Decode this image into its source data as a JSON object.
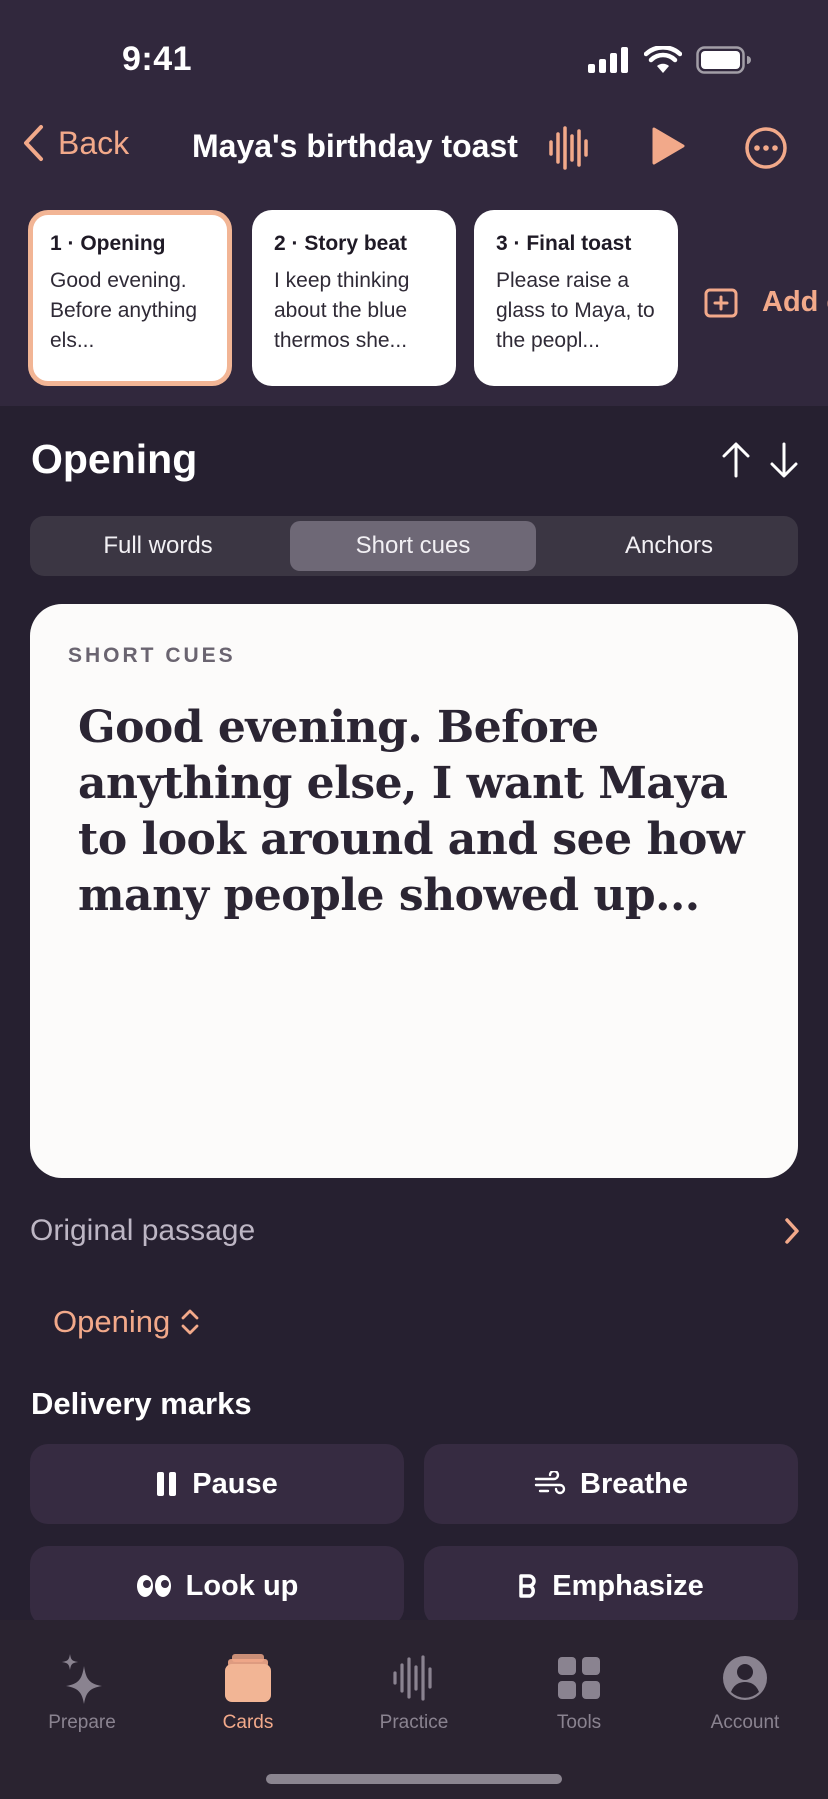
{
  "status_bar": {
    "time": "9:41"
  },
  "nav": {
    "back_label": "Back",
    "title": "Maya's birthday toast",
    "icons": [
      "chevron-left-icon",
      "waveform-icon",
      "play-icon",
      "more-icon"
    ]
  },
  "cards": [
    {
      "title": "1 · Opening",
      "preview": "Good evening. Before anything els..."
    },
    {
      "title": "2 · Story beat",
      "preview": "I keep thinking about the blue thermos she..."
    },
    {
      "title": "3 · Final toast",
      "preview": "Please raise a glass to Maya, to the peopl..."
    }
  ],
  "add_card_label": "Add c",
  "section": {
    "title": "Opening"
  },
  "modes": {
    "options": [
      "Full words",
      "Short cues",
      "Anchors"
    ],
    "selected": "Short cues"
  },
  "cue_card": {
    "label": "SHORT CUES",
    "text": "Good evening. Before anything else, I want Maya to look around and see how many people showed up..."
  },
  "original_passage": {
    "label": "Original passage"
  },
  "picker": {
    "value": "Opening"
  },
  "delivery_marks": {
    "title": "Delivery marks",
    "items": [
      {
        "label": "Pause",
        "icon": "pause-icon"
      },
      {
        "label": "Breathe",
        "icon": "wind-icon"
      },
      {
        "label": "Look up",
        "icon": "eyes-icon"
      },
      {
        "label": "Emphasize",
        "icon": "bold-icon"
      }
    ]
  },
  "tabs": [
    {
      "label": "Prepare",
      "icon": "sparkles-icon"
    },
    {
      "label": "Cards",
      "icon": "cards-icon"
    },
    {
      "label": "Practice",
      "icon": "waveform-icon"
    },
    {
      "label": "Tools",
      "icon": "grid-icon"
    },
    {
      "label": "Account",
      "icon": "person-icon"
    }
  ],
  "active_tab": "Cards",
  "colors": {
    "accent": "#f2a98a",
    "background": "#262030",
    "header": "#31283d",
    "card": "#fcfbfa"
  }
}
